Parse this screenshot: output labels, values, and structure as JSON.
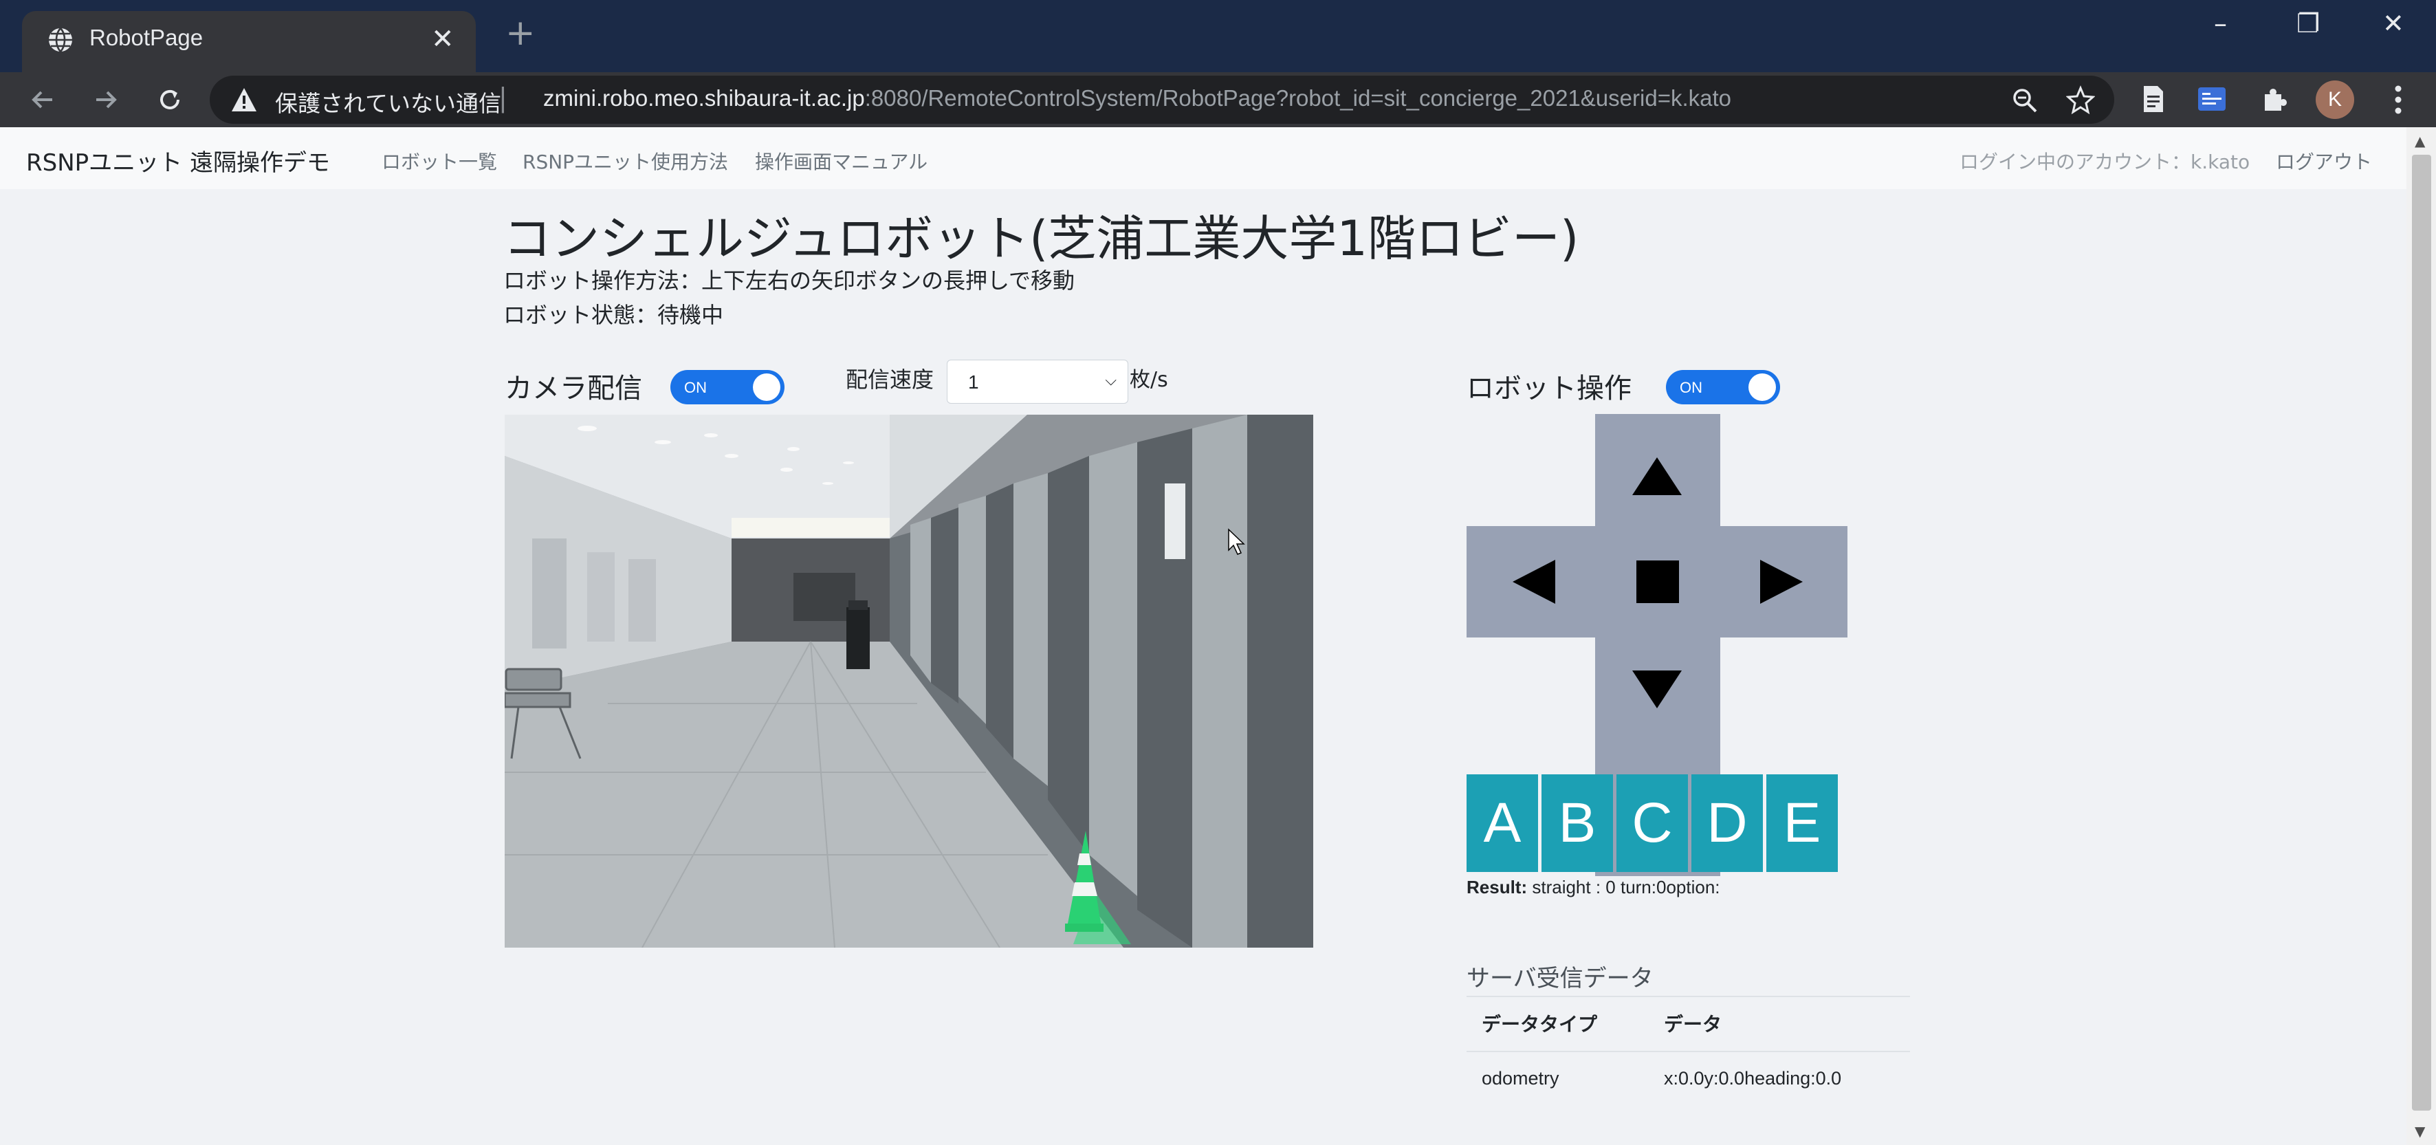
{
  "browser": {
    "tab_title": "RobotPage",
    "tab_close": "✕",
    "new_tab": "+",
    "security_label": "保護されていない通信",
    "url_host": "zmini.robo.meo.shibaura-it.ac.jp",
    "url_rest": ":8080/RemoteControlSystem/RobotPage?robot_id=sit_concierge_2021&userid=k.kato",
    "avatar_letter": "K",
    "window_controls": [
      "–",
      "❐",
      "✕"
    ]
  },
  "navbar": {
    "brand": "RSNPユニット 遠隔操作デモ",
    "links": [
      "ロボット一覧",
      "RSNPユニット使用方法",
      "操作画面マニュアル"
    ],
    "account": "ログイン中のアカウント：k.kato",
    "logout": "ログアウト"
  },
  "main": {
    "title": "コンシェルジュロボット(芝浦工業大学1階ロビー)",
    "instructions": "ロボット操作方法：上下左右の矢印ボタンの長押しで移動",
    "status": "ロボット状態：待機中"
  },
  "camera": {
    "label": "カメラ配信",
    "toggle": "ON",
    "rate_label": "配信速度",
    "rate_value": "1",
    "rate_unit": "枚/s"
  },
  "robot_control": {
    "label": "ロボット操作",
    "toggle": "ON",
    "letter_buttons": [
      "A",
      "B",
      "C",
      "D",
      "E"
    ],
    "result_label": "Result:",
    "result_value": " straight : 0 turn:0option:"
  },
  "server_data": {
    "title": "サーバ受信データ",
    "headers": [
      "データタイプ",
      "データ"
    ],
    "rows": [
      {
        "type": "odometry",
        "data": "x:0.0y:0.0heading:0.0"
      }
    ]
  },
  "colors": {
    "toggle_on": "#1a73e8",
    "dpad": "#98a1b4",
    "letter_button": "#1ca0b4"
  }
}
